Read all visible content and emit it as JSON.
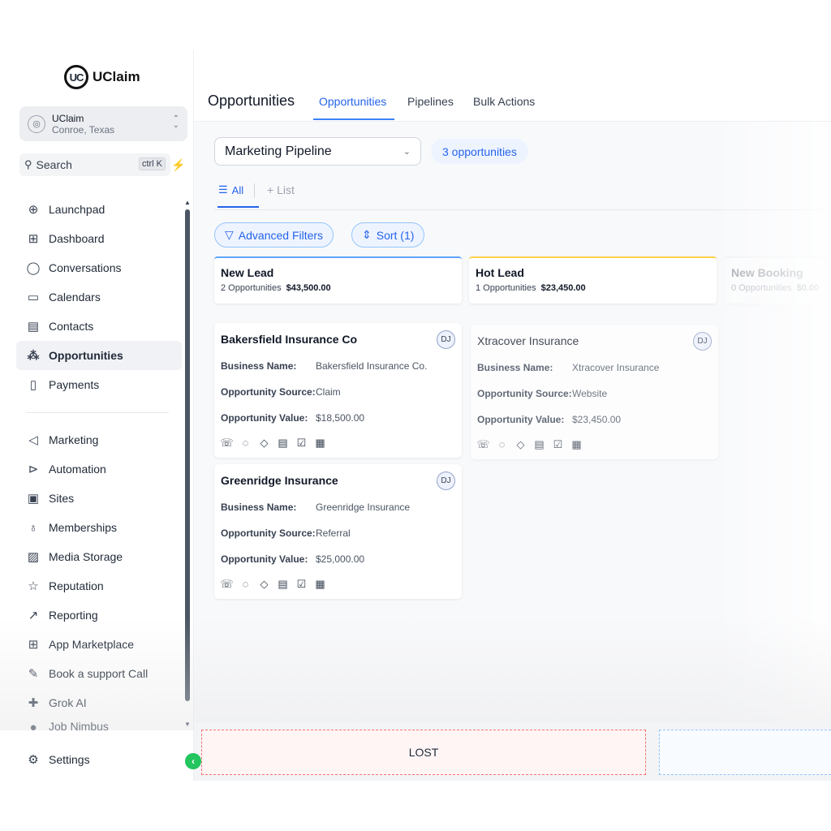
{
  "brand": {
    "logo_mark": "UC",
    "name": "UClaim"
  },
  "account": {
    "name": "UClaim",
    "location": "Conroe, Texas"
  },
  "search": {
    "label": "Search",
    "shortcut": "ctrl K"
  },
  "sidebar": {
    "items": [
      {
        "label": "Launchpad",
        "icon": "rocket-icon",
        "glyph": "⊕"
      },
      {
        "label": "Dashboard",
        "icon": "grid-icon",
        "glyph": "⊞"
      },
      {
        "label": "Conversations",
        "icon": "chat-icon",
        "glyph": "◯"
      },
      {
        "label": "Calendars",
        "icon": "calendar-icon",
        "glyph": "▭"
      },
      {
        "label": "Contacts",
        "icon": "contacts-icon",
        "glyph": "▤"
      },
      {
        "label": "Opportunities",
        "icon": "opportunities-icon",
        "glyph": "⁂"
      },
      {
        "label": "Payments",
        "icon": "payments-icon",
        "glyph": "▯"
      },
      {
        "label": "Marketing",
        "icon": "send-icon",
        "glyph": "◁"
      },
      {
        "label": "Automation",
        "icon": "automation-icon",
        "glyph": "⊳"
      },
      {
        "label": "Sites",
        "icon": "sites-icon",
        "glyph": "▣"
      },
      {
        "label": "Memberships",
        "icon": "award-icon",
        "glyph": "♁"
      },
      {
        "label": "Media Storage",
        "icon": "image-icon",
        "glyph": "▨"
      },
      {
        "label": "Reputation",
        "icon": "star-icon",
        "glyph": "☆"
      },
      {
        "label": "Reporting",
        "icon": "trend-icon",
        "glyph": "↗"
      },
      {
        "label": "App Marketplace",
        "icon": "apps-icon",
        "glyph": "⊞"
      },
      {
        "label": "Book a support Call",
        "icon": "wrench-icon",
        "glyph": "✎"
      },
      {
        "label": "Grok AI",
        "icon": "user-plus-icon",
        "glyph": "✚"
      },
      {
        "label": "Job Nimbus",
        "icon": "user-icon",
        "glyph": "●"
      },
      {
        "label": "Settings",
        "icon": "gear-icon",
        "glyph": "⚙"
      }
    ]
  },
  "header": {
    "title": "Opportunities",
    "tabs": [
      {
        "label": "Opportunities"
      },
      {
        "label": "Pipelines"
      },
      {
        "label": "Bulk Actions"
      }
    ]
  },
  "toolbar": {
    "pipeline": "Marketing Pipeline",
    "count_badge": "3 opportunities",
    "view_all": "All",
    "view_list": "+ List",
    "advanced_filters": "Advanced Filters",
    "sort": "Sort (1)"
  },
  "stages": [
    {
      "name": "New Lead",
      "count": "2 Opportunities",
      "total": "$43,500.00",
      "color": "#60a5fa"
    },
    {
      "name": "Hot Lead",
      "count": "1 Opportunities",
      "total": "$23,450.00",
      "color": "#fcd34d"
    },
    {
      "name": "New Booking",
      "count": "0 Opportunities",
      "total": "$0.00",
      "color": "#e5e7eb"
    }
  ],
  "cards": [
    {
      "title": "Bakersfield Insurance Co",
      "avatar": "DJ",
      "business_key": "Business Name:",
      "business": "Bakersfield Insurance Co.",
      "source_key": "Opportunity Source:",
      "source": "Claim",
      "value_key": "Opportunity Value:",
      "value": "$18,500.00"
    },
    {
      "title": "Greenridge Insurance",
      "avatar": "DJ",
      "business_key": "Business Name:",
      "business": "Greenridge Insurance",
      "source_key": "Opportunity Source:",
      "source": "Referral",
      "value_key": "Opportunity Value:",
      "value": "$25,000.00"
    },
    {
      "title": "Xtracover Insurance",
      "avatar": "DJ",
      "business_key": "Business Name:",
      "business": "Xtracover Insurance",
      "source_key": "Opportunity Source:",
      "source": "Website",
      "value_key": "Opportunity Value:",
      "value": "$23,450.00"
    }
  ],
  "dropzones": {
    "lost": "LOST"
  },
  "colors": {
    "accent": "#2563eb",
    "success": "#22c55e",
    "lost": "#f87171"
  }
}
